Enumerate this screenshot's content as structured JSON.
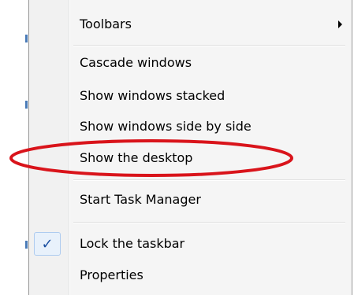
{
  "menu": {
    "items": [
      {
        "label": "Toolbars",
        "has_submenu": true
      },
      {
        "label": "Cascade windows"
      },
      {
        "label": "Show windows stacked"
      },
      {
        "label": "Show windows side by side"
      },
      {
        "label": "Show the desktop",
        "circled": true
      },
      {
        "label": "Start Task Manager"
      },
      {
        "label": "Lock the taskbar",
        "checked": true
      },
      {
        "label": "Properties"
      }
    ],
    "check_glyph": "✓"
  },
  "colors": {
    "annotation_ellipse": "#d9141b",
    "check": "#1b4fa0",
    "menu_background": "#f5f5f5"
  },
  "icons": {
    "submenu": "chevron-right-icon",
    "check": "checkmark-icon"
  }
}
